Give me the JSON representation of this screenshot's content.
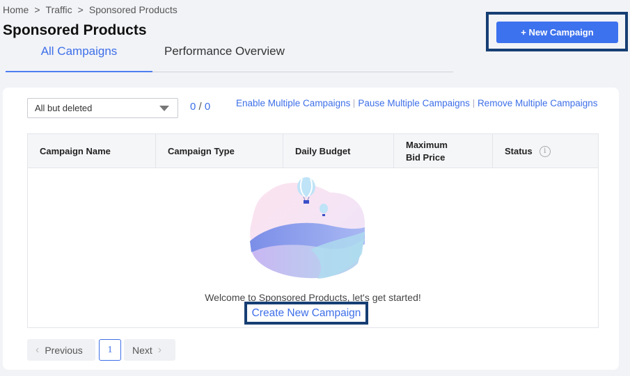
{
  "breadcrumb": {
    "items": [
      "Home",
      "Traffic",
      "Sponsored Products"
    ],
    "separator": ">"
  },
  "page": {
    "title": "Sponsored Products"
  },
  "tabs": [
    {
      "label": "All Campaigns",
      "active": true
    },
    {
      "label": "Performance Overview",
      "active": false
    }
  ],
  "header": {
    "new_campaign_label": "+ New Campaign"
  },
  "filter": {
    "selected": "All but deleted",
    "selected_count": "0",
    "total_count": "0",
    "count_separator": "/"
  },
  "bulk_actions": {
    "enable": "Enable Multiple Campaigns",
    "pause": "Pause Multiple Campaigns",
    "remove": "Remove Multiple Campaigns"
  },
  "table": {
    "columns": {
      "name": "Campaign Name",
      "type": "Campaign Type",
      "budget": "Daily Budget",
      "bid_line1": "Maximum",
      "bid_line2": "Bid Price",
      "status": "Status"
    },
    "status_info_icon": "info-icon"
  },
  "empty_state": {
    "message": "Welcome to Sponsored Products, let's get started!",
    "cta": "Create New Campaign"
  },
  "pagination": {
    "previous": "Previous",
    "current_page": "1",
    "next": "Next"
  },
  "colors": {
    "accent": "#3d6fe8",
    "highlight_border": "#163e73",
    "button_bg": "#3d72ee"
  }
}
